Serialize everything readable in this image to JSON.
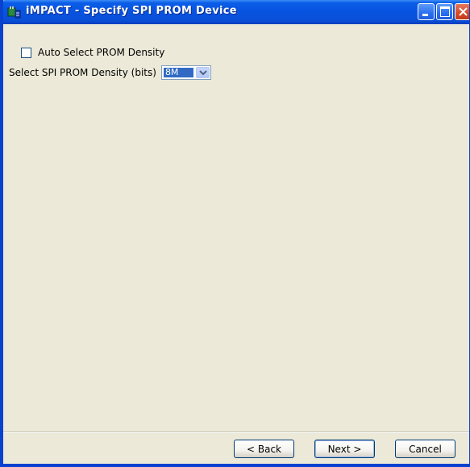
{
  "window": {
    "title": "iMPACT - Specify SPI PROM Device"
  },
  "form": {
    "auto_select_label": "Auto Select PROM Density",
    "auto_select_checked": false,
    "density_label": "Select SPI PROM Density (bits)",
    "density_value": "8M"
  },
  "buttons": {
    "back": "< Back",
    "next": "Next >",
    "cancel": "Cancel"
  },
  "icons": {
    "app": "impact-app-icon",
    "minimize": "minimize-icon",
    "maximize": "maximize-icon",
    "close": "close-icon",
    "dropdown": "chevron-down-icon"
  }
}
